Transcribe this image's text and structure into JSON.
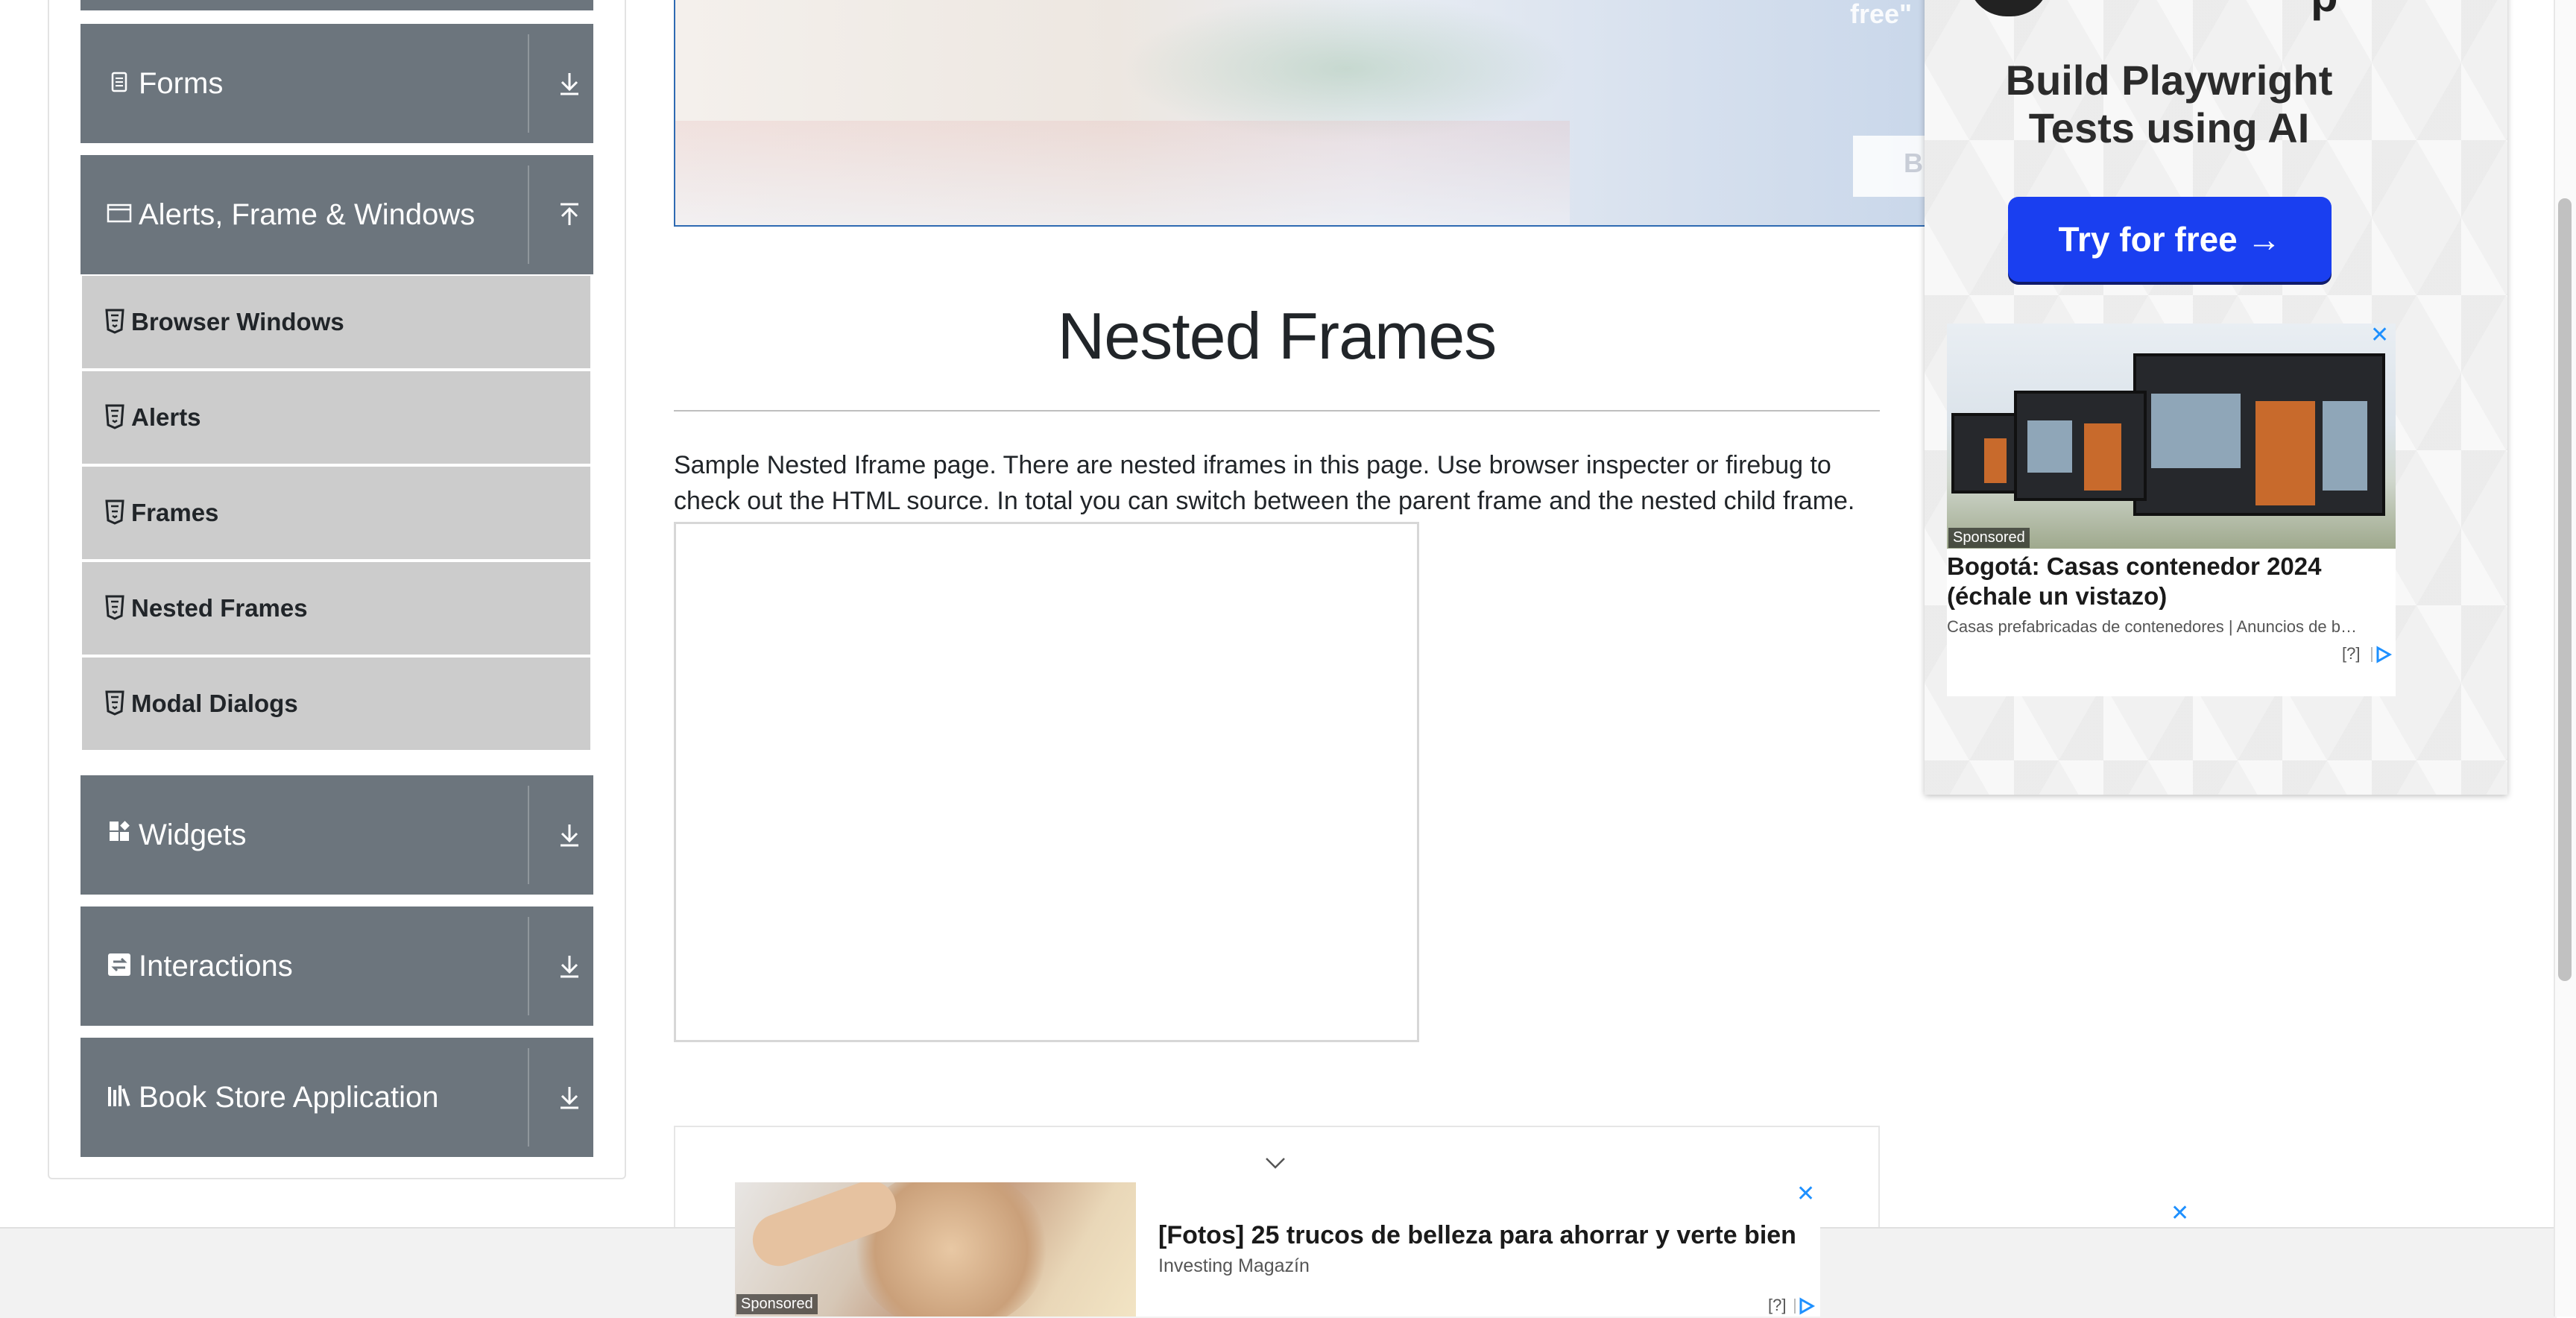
{
  "sidebar": {
    "groups": [
      {
        "label": "Forms",
        "icon": "form-icon",
        "arrow": "download-arrow-icon"
      },
      {
        "label": "Alerts, Frame & Windows",
        "icon": "window-icon",
        "arrow": "upload-arrow-icon"
      },
      {
        "label": "Widgets",
        "icon": "widgets-icon",
        "arrow": "download-arrow-icon"
      },
      {
        "label": "Interactions",
        "icon": "interactions-icon",
        "arrow": "download-arrow-icon"
      },
      {
        "label": "Book Store Application",
        "icon": "book-icon",
        "arrow": "download-arrow-icon"
      }
    ],
    "items": [
      {
        "label": "Browser Windows"
      },
      {
        "label": "Alerts"
      },
      {
        "label": "Frames"
      },
      {
        "label": "Nested Frames"
      },
      {
        "label": "Modal Dialogs"
      }
    ]
  },
  "top_banner": {
    "free_text": "free\"",
    "button_text": "B"
  },
  "main": {
    "title": "Nested Frames",
    "description": "Sample Nested Iframe page. There are nested iframes in this page. Use browser inspecter or firebug to check out the HTML source. In total you can switch between the parent frame and the nested child frame."
  },
  "right_ad": {
    "logo_letter": "p",
    "headline": "Build Playwright Tests using AI",
    "cta": "Try for free →",
    "card": {
      "sponsored": "Sponsored",
      "title": "Bogotá: Casas contenedor 2024 (échale un vistazo)",
      "source": "Casas prefabricadas de contenedores | Anuncios de b…",
      "info": "[?]",
      "close": "✕"
    }
  },
  "bottom_ad": {
    "sponsored": "Sponsored",
    "title": "[Fotos] 25 trucos de belleza para ahorrar y verte bien",
    "source": "Investing Magazín",
    "info": "[?]",
    "close": "✕",
    "floating_close": "✕"
  },
  "colors": {
    "sidebar_header": "#6c757d",
    "sidebar_item": "#cccccc",
    "cta_blue": "#1a3ff0",
    "ad_link_blue": "#1e90ff"
  }
}
